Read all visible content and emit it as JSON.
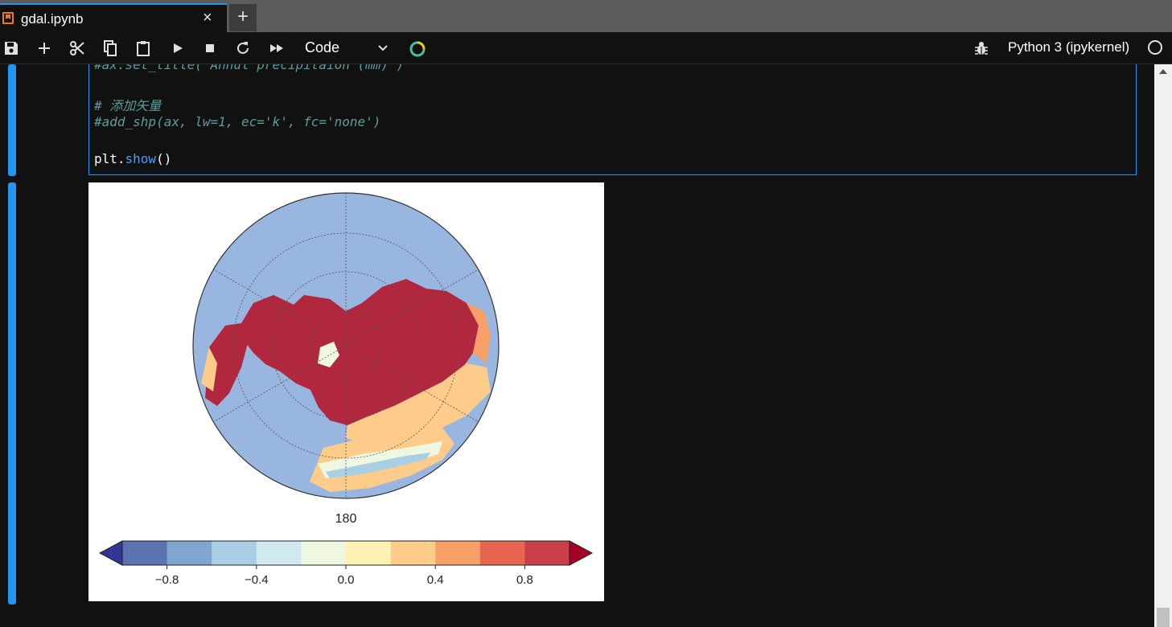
{
  "tab": {
    "title": "gdal.ipynb",
    "close_icon": "×",
    "add_icon": "+"
  },
  "toolbar": {
    "buttons": [
      "save-icon",
      "add-cell-icon",
      "cut-icon",
      "copy-icon",
      "paste-icon",
      "run-icon",
      "stop-icon",
      "restart-icon",
      "run-all-icon"
    ],
    "cell_type": "Code",
    "kernel_name": "Python 3 (ipykernel)"
  },
  "code": {
    "line1": "#ax.set_title('Annul precipitaion (mm)')",
    "line2": "# 添加矢量",
    "line3": "#add_shp(ax, lw=1, ec='k', fc='none')",
    "line4_obj": "plt.",
    "line4_func": "show",
    "line4_paren": "()"
  },
  "chart_data": {
    "type": "heatmap",
    "projection": "north-polar-stereographic",
    "meridian_label": "180",
    "colorbar": {
      "min": -1.0,
      "max": 1.0,
      "step": 0.2,
      "extend": "both",
      "ticks": [
        -0.8,
        -0.4,
        0.0,
        0.4,
        0.8
      ],
      "tick_labels": [
        "−0.8",
        "−0.4",
        "0.0",
        "0.4",
        "0.8"
      ],
      "colors": [
        "#313695",
        "#5b73b3",
        "#7fa6cf",
        "#aacfe4",
        "#d2e9f2",
        "#eef7df",
        "#fff2b3",
        "#fdcc8a",
        "#f89f68",
        "#e7664f",
        "#c9404a",
        "#a50026"
      ]
    },
    "background_color": "#98b6df",
    "land_color": "#b1283e"
  }
}
